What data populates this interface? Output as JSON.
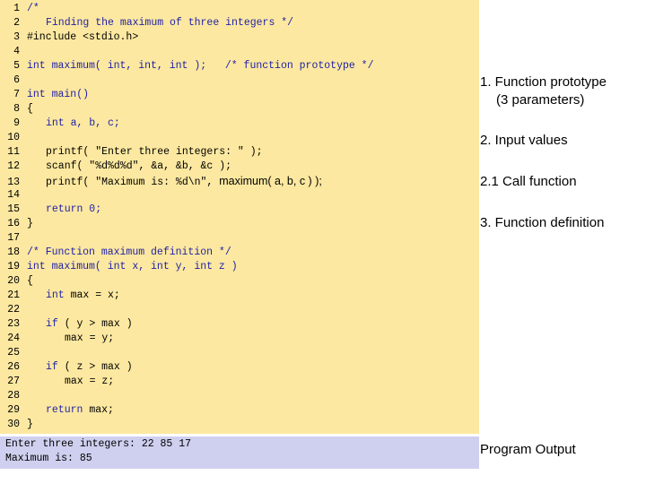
{
  "code_lines": [
    {
      "n": "1",
      "indent": 0,
      "segs": [
        {
          "t": "/*",
          "c": "c-blue"
        }
      ]
    },
    {
      "n": "2",
      "indent": 3,
      "segs": [
        {
          "t": "Finding the maximum of three integers */",
          "c": "c-blue"
        }
      ]
    },
    {
      "n": "3",
      "indent": 0,
      "segs": [
        {
          "t": "#include <stdio.h>",
          "c": "c-black"
        }
      ]
    },
    {
      "n": "4",
      "indent": 0,
      "segs": []
    },
    {
      "n": "5",
      "indent": 0,
      "segs": [
        {
          "t": "int maximum( int, int, int );",
          "c": "c-blue"
        },
        {
          "t": "   /* function prototype */",
          "c": "c-blue"
        }
      ]
    },
    {
      "n": "6",
      "indent": 0,
      "segs": []
    },
    {
      "n": "7",
      "indent": 0,
      "segs": [
        {
          "t": "int main()",
          "c": "c-blue"
        }
      ]
    },
    {
      "n": "8",
      "indent": 0,
      "segs": [
        {
          "t": "{",
          "c": "c-black"
        }
      ]
    },
    {
      "n": "9",
      "indent": 3,
      "segs": [
        {
          "t": "int a, b, c;",
          "c": "c-blue"
        }
      ]
    },
    {
      "n": "10",
      "indent": 0,
      "segs": []
    },
    {
      "n": "11",
      "indent": 3,
      "segs": [
        {
          "t": "printf( \"Enter three integers: \" );",
          "c": "c-black"
        }
      ]
    },
    {
      "n": "12",
      "indent": 3,
      "segs": [
        {
          "t": "scanf( \"%d%d%d\", &a, &b, &c );",
          "c": "c-black"
        }
      ]
    },
    {
      "n": "13",
      "indent": 3,
      "segs": [
        {
          "t": "printf( \"Maximum is: %d\\n\", ",
          "c": "c-black"
        },
        {
          "t": "maximum( a, b, c ) );",
          "c": "c-black c-sans"
        }
      ]
    },
    {
      "n": "14",
      "indent": 0,
      "segs": []
    },
    {
      "n": "15",
      "indent": 3,
      "segs": [
        {
          "t": "return 0;",
          "c": "c-blue"
        }
      ]
    },
    {
      "n": "16",
      "indent": 0,
      "segs": [
        {
          "t": "}",
          "c": "c-black"
        }
      ]
    },
    {
      "n": "17",
      "indent": 0,
      "segs": []
    },
    {
      "n": "18",
      "indent": 0,
      "segs": [
        {
          "t": "/* Function maximum definition */",
          "c": "c-blue"
        }
      ]
    },
    {
      "n": "19",
      "indent": 0,
      "segs": [
        {
          "t": "int maximum( int x, int y, int z )",
          "c": "c-blue"
        }
      ]
    },
    {
      "n": "20",
      "indent": 0,
      "segs": [
        {
          "t": "{",
          "c": "c-black"
        }
      ]
    },
    {
      "n": "21",
      "indent": 3,
      "segs": [
        {
          "t": "int",
          "c": "c-blue"
        },
        {
          "t": " max = x;",
          "c": "c-black"
        }
      ]
    },
    {
      "n": "22",
      "indent": 0,
      "segs": []
    },
    {
      "n": "23",
      "indent": 3,
      "segs": [
        {
          "t": "if",
          "c": "c-blue"
        },
        {
          "t": " ( y > max )",
          "c": "c-black"
        }
      ]
    },
    {
      "n": "24",
      "indent": 6,
      "segs": [
        {
          "t": "max = y;",
          "c": "c-black"
        }
      ]
    },
    {
      "n": "25",
      "indent": 0,
      "segs": []
    },
    {
      "n": "26",
      "indent": 3,
      "segs": [
        {
          "t": "if",
          "c": "c-blue"
        },
        {
          "t": " ( z > max )",
          "c": "c-black"
        }
      ]
    },
    {
      "n": "27",
      "indent": 6,
      "segs": [
        {
          "t": "max = z;",
          "c": "c-black"
        }
      ]
    },
    {
      "n": "28",
      "indent": 0,
      "segs": []
    },
    {
      "n": "29",
      "indent": 3,
      "segs": [
        {
          "t": "return",
          "c": "c-blue"
        },
        {
          "t": " max;",
          "c": "c-black"
        }
      ]
    },
    {
      "n": "30",
      "indent": 0,
      "segs": [
        {
          "t": "}",
          "c": "c-black"
        }
      ]
    }
  ],
  "output_lines": [
    "Enter three integers: 22 85 17",
    "Maximum is: 85"
  ],
  "annotations": {
    "function_prototype": "1.  Function prototype",
    "function_prototype_sub": "(3 parameters)",
    "input_values": "2.  Input values",
    "call_function": "2.1  Call function",
    "function_definition": "3. Function definition",
    "program_output": "Program Output"
  },
  "colors": {
    "code_background": "#fce8a0",
    "output_background": "#cfcfef",
    "keyword_blue": "#1f1fa8"
  }
}
